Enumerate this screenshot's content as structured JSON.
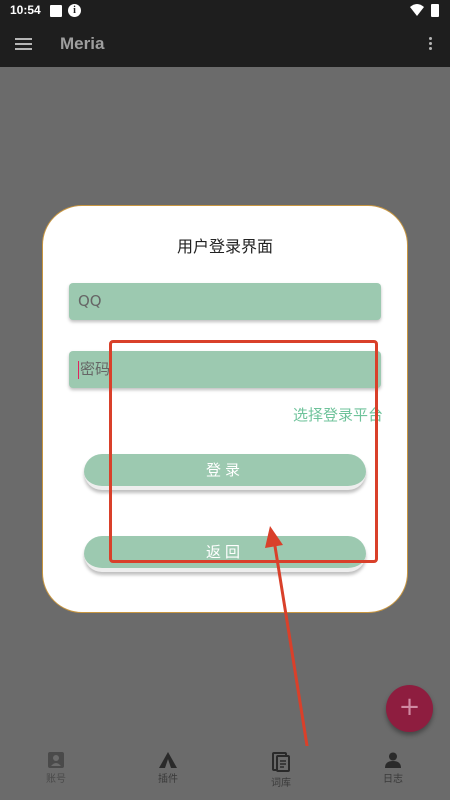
{
  "status": {
    "time": "10:54"
  },
  "appbar": {
    "title": "Meria"
  },
  "dialog": {
    "title": "用户登录界面",
    "qq_placeholder": "QQ",
    "password_placeholder": "密码",
    "platform_link": "选择登录平台",
    "login_label": "登录",
    "back_label": "返回"
  },
  "nav": {
    "items": [
      {
        "label": "账号",
        "icon": "account-box-icon"
      },
      {
        "label": "插件",
        "icon": "plugin-icon"
      },
      {
        "label": "词库",
        "icon": "document-icon"
      },
      {
        "label": "日志",
        "icon": "person-icon"
      }
    ]
  },
  "colors": {
    "field": "#9cc9b0",
    "fab": "#8e1d3f",
    "annotation": "#d9402a",
    "link": "#6fc39b"
  }
}
